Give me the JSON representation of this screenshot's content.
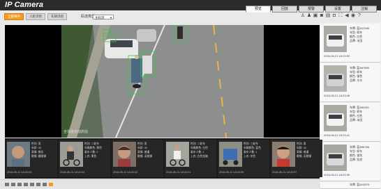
{
  "app": {
    "title": "IP Camera"
  },
  "nav": {
    "tabs": [
      {
        "label": "预览",
        "active": true
      },
      {
        "label": "回放",
        "active": false
      },
      {
        "label": "报警",
        "active": false
      },
      {
        "label": "设置",
        "active": false
      },
      {
        "label": "注销",
        "active": false
      }
    ]
  },
  "toolbar": {
    "buttons": [
      {
        "label": "全部事件",
        "active": true
      },
      {
        "label": "人脸识别",
        "active": false
      },
      {
        "label": "车辆识别",
        "active": false
      }
    ],
    "stream_label": "码流类型:",
    "stream_value": "主码流"
  },
  "video": {
    "overlay_text": "全场景自动抓拍"
  },
  "colors": {
    "accent": "#f39a21",
    "header_bg": "#2b2b2b",
    "detect_box": "#2ecc40"
  },
  "top_icons": [
    "person-icon",
    "person-capture-icon",
    "camera-icon",
    "snapshot-icon",
    "video-icon",
    "record-icon",
    "fullscreen-icon",
    "volume-icon",
    "mic-icon",
    "help-icon"
  ],
  "right_panel": {
    "items": [
      {
        "lines": [
          "车牌: 蓝A12345",
          "车型: 轿车",
          "颜色: 白色",
          "品牌: 丰田"
        ],
        "time": "2018-06-21 18:23:52"
      },
      {
        "lines": [
          "车牌: 蓝A67890",
          "车型: 轿车",
          "颜色: 银色",
          "品牌: 大众"
        ],
        "time": "2018-06-21 18:23:48"
      },
      {
        "lines": [
          "车牌: 蓝A54321",
          "车型: 轿车",
          "颜色: 白色",
          "品牌: 本田"
        ],
        "time": "2018-06-21 18:23:41"
      },
      {
        "lines": [
          "车牌: 蓝A98765",
          "车型: 轿车",
          "颜色: 银色",
          "品牌: 别克"
        ],
        "time": "2018-06-21 18:23:35"
      },
      {
        "lines": [
          "车牌: 蓝A13579"
        ],
        "time": ""
      }
    ]
  },
  "bottom_strip": {
    "items": [
      {
        "lines": [
          "性别: 男",
          "年龄: 33",
          "表情: 微笑",
          "眼镜: 戴眼镜"
        ],
        "time": "2018-06-21 18:24:03"
      },
      {
        "lines": [
          "性别: 二轮车",
          "车辆颜色: 黑色",
          "乘车人数: 2",
          "上衣: 黑色"
        ],
        "time": "2018-06-21 18:24:02"
      },
      {
        "lines": [
          "性别: 男",
          "年龄: 30",
          "表情: 普通",
          "眼镜: 无眼镜"
        ],
        "time": "2018-06-21 18:24:02"
      },
      {
        "lines": [
          "性别: 二轮车",
          "车辆颜色: 白色",
          "乘车人数: 1",
          "上衣: 白色短袖"
        ],
        "time": "2018-06-21 18:24:01"
      },
      {
        "lines": [
          "性别: 三轮车",
          "车辆颜色: 蓝色",
          "乘车人数: 1",
          "上衣: 灰色"
        ],
        "time": "2018-06-21 18:23:59"
      },
      {
        "lines": [
          "性别: 男",
          "年龄: 32",
          "表情: 普通",
          "眼镜: 无眼镜"
        ],
        "time": "2018-06-21 18:23:57"
      }
    ]
  }
}
